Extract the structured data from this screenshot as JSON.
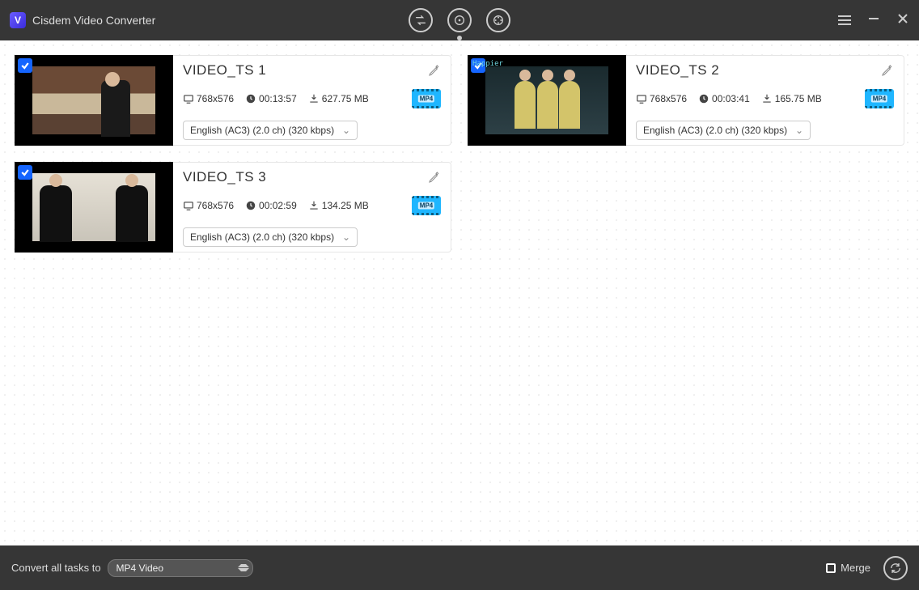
{
  "app": {
    "title": "Cisdem Video Converter"
  },
  "tabs": {
    "convert": "convert",
    "rip": "rip",
    "download": "download",
    "active": 1
  },
  "videos": [
    {
      "title": "VIDEO_TS 1",
      "resolution": "768x576",
      "duration": "00:13:57",
      "size": "627.75 MB",
      "audio": "English (AC3) (2.0 ch) (320 kbps)",
      "format_badge": "MP4"
    },
    {
      "title": "VIDEO_TS 2",
      "resolution": "768x576",
      "duration": "00:03:41",
      "size": "165.75 MB",
      "audio": "English (AC3) (2.0 ch) (320 kbps)",
      "format_badge": "MP4",
      "overlay_text": "Happier"
    },
    {
      "title": "VIDEO_TS 3",
      "resolution": "768x576",
      "duration": "00:02:59",
      "size": "134.25 MB",
      "audio": "English (AC3) (2.0 ch) (320 kbps)",
      "format_badge": "MP4"
    }
  ],
  "footer": {
    "convert_label": "Convert all tasks to",
    "target_format": "MP4 Video",
    "merge_label": "Merge"
  }
}
